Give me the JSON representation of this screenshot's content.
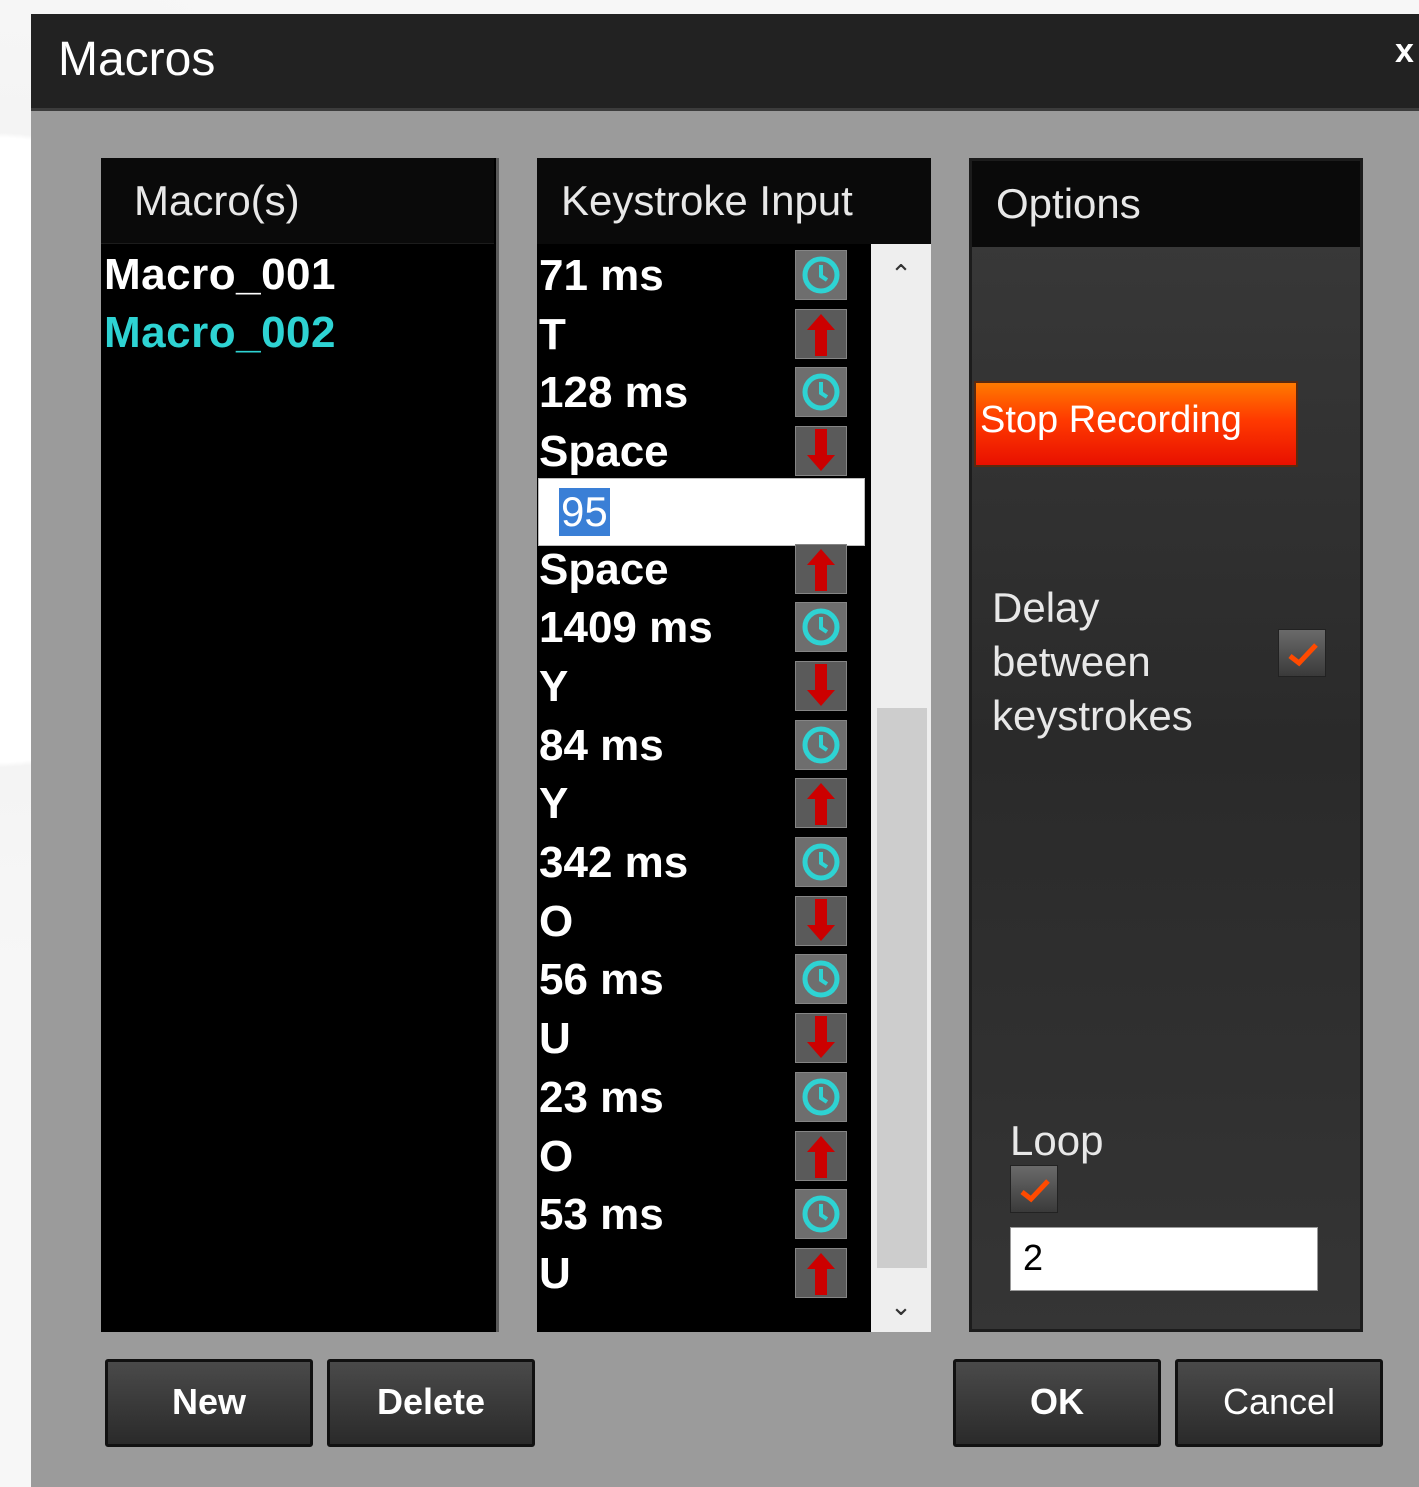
{
  "window": {
    "title": "Macros",
    "close_label": "x"
  },
  "macros": {
    "header": "Macro(s)",
    "items": [
      {
        "label": "Macro_001",
        "selected": false
      },
      {
        "label": "Macro_002",
        "selected": true
      }
    ]
  },
  "keystrokes": {
    "header": "Keystroke Input",
    "edit_value": "95",
    "rows": [
      {
        "text": "71 ms",
        "icon": "clock-icon"
      },
      {
        "text": "T",
        "icon": "arrow-up-icon"
      },
      {
        "text": "128 ms",
        "icon": "clock-icon"
      },
      {
        "text": "Space",
        "icon": "arrow-down-icon"
      },
      {
        "text": "95",
        "icon": "edit-field"
      },
      {
        "text": "Space",
        "icon": "arrow-up-icon"
      },
      {
        "text": "1409 ms",
        "icon": "clock-icon"
      },
      {
        "text": "Y",
        "icon": "arrow-down-icon"
      },
      {
        "text": "84 ms",
        "icon": "clock-icon"
      },
      {
        "text": "Y",
        "icon": "arrow-up-icon"
      },
      {
        "text": "342 ms",
        "icon": "clock-icon"
      },
      {
        "text": "O",
        "icon": "arrow-down-icon"
      },
      {
        "text": "56 ms",
        "icon": "clock-icon"
      },
      {
        "text": "U",
        "icon": "arrow-down-icon"
      },
      {
        "text": "23 ms",
        "icon": "clock-icon"
      },
      {
        "text": "O",
        "icon": "arrow-up-icon"
      },
      {
        "text": "53 ms",
        "icon": "clock-icon"
      },
      {
        "text": "U",
        "icon": "arrow-up-icon"
      }
    ]
  },
  "options": {
    "header": "Options",
    "stop_recording": "Stop Recording",
    "delay_label": "Delay between keystrokes",
    "delay_checked": true,
    "loop_label": "Loop",
    "loop_checked": true,
    "loop_count": "2"
  },
  "buttons": {
    "new": "New",
    "delete": "Delete",
    "ok": "OK",
    "cancel": "Cancel"
  },
  "colors": {
    "selected_macro": "#2ed3d3",
    "stop_button": "#ff3a00",
    "arrow_red": "#cc0000",
    "clock_cyan": "#2ed3d3"
  }
}
